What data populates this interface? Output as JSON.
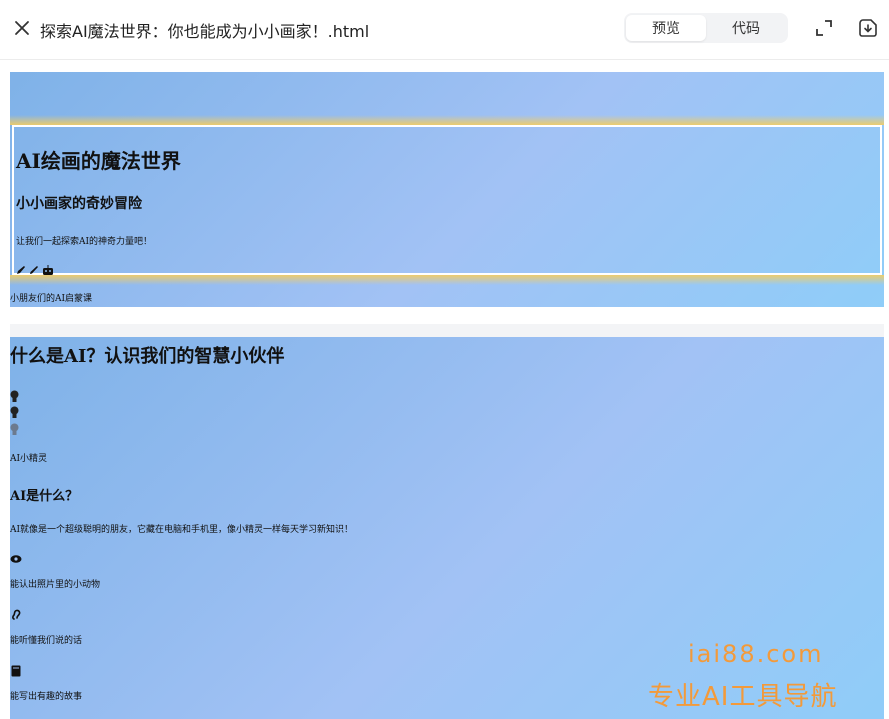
{
  "toolbar": {
    "file_title": "探索AI魔法世界：你也能成为小小画家！.html",
    "tabs": [
      {
        "label": "预览",
        "active": true
      },
      {
        "label": "代码",
        "active": false
      }
    ],
    "icons": [
      "close-icon",
      "expand-icon",
      "download-icon"
    ]
  },
  "hero": {
    "title": "AI绘画的魔法世界",
    "subtitle": "小小画家的奇妙冒险",
    "description": "让我们一起探索AI的神奇力量吧！",
    "icons": [
      "paintbrush-icon",
      "pencil-icon",
      "robot-icon"
    ],
    "caption": "小朋友们的AI启蒙课"
  },
  "section": {
    "title": "什么是AI？认识我们的智慧小伙伴",
    "bulb_icons": [
      "lightbulb-icon",
      "lightbulb-icon",
      "lightbulb-icon"
    ],
    "mascot_label": "AI小精灵",
    "heading": "AI是什么？",
    "intro": "AI就像是一个超级聪明的朋友，它藏在电脑和手机里，像小精灵一样每天学习新知识！",
    "features": [
      {
        "icon": "eye-icon",
        "text": "能认出照片里的小动物"
      },
      {
        "icon": "ear-icon",
        "text": "能听懂我们说的话"
      },
      {
        "icon": "book-icon",
        "text": "能写出有趣的故事"
      }
    ]
  },
  "watermark": {
    "domain": "iai88.com",
    "tagline": "专业AI工具导航"
  },
  "colors": {
    "accent_watermark": "#f39a3a",
    "gradient_start": "#7fb2e8",
    "gradient_mid": "#a2c2f5",
    "gradient_end": "#8fcdf8",
    "gold_band": "#f5cd5f"
  }
}
